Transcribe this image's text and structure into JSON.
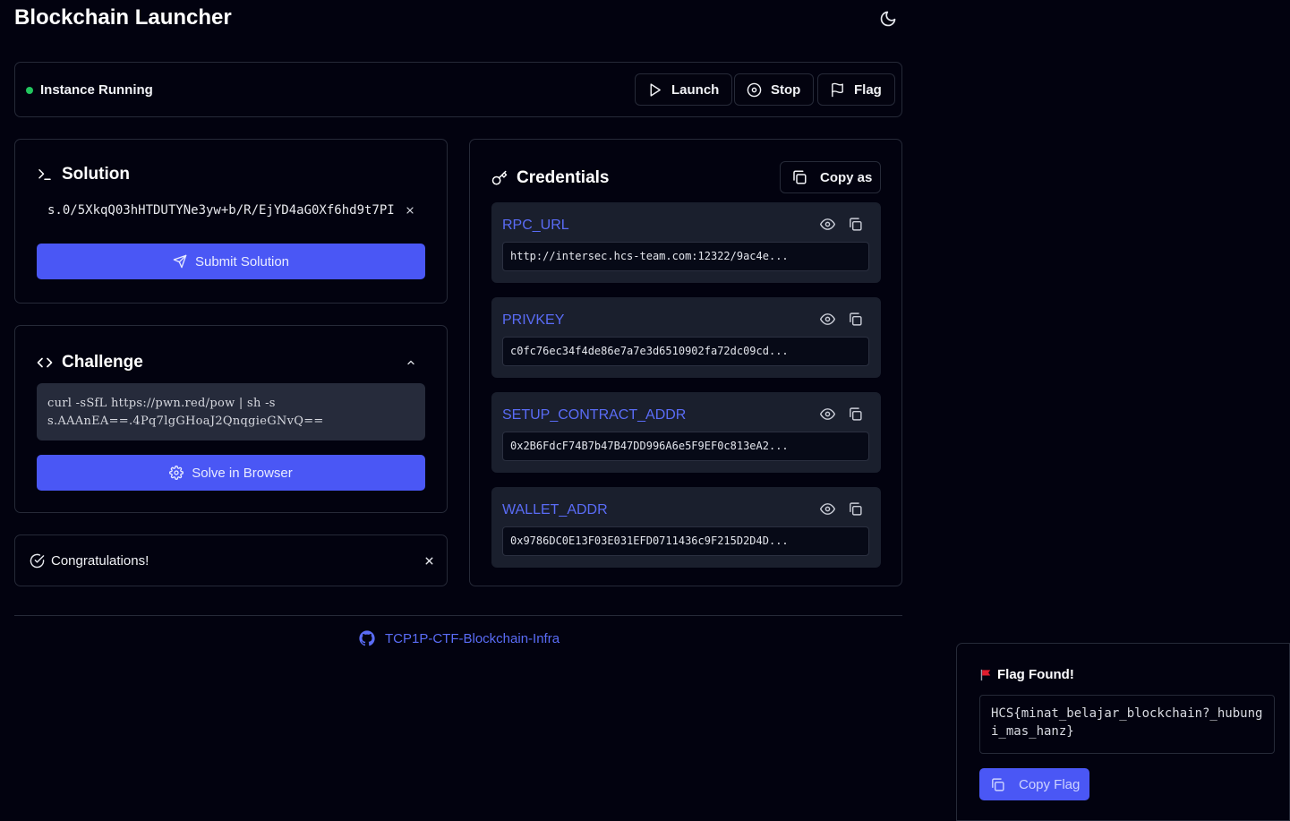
{
  "app": {
    "title": "Blockchain Launcher",
    "theme_icon": "moon-icon"
  },
  "status": {
    "text": "Instance Running",
    "dot_color": "#22c55e",
    "buttons": {
      "launch": "Launch",
      "stop": "Stop",
      "flag": "Flag"
    }
  },
  "solution": {
    "title": "Solution",
    "value": "s.0/5XkqQ03hHTDUTYNe3yw+b/R/EjYD4aG0Xf6hd9t7PI",
    "submit_label": "Submit Solution"
  },
  "challenge": {
    "title": "Challenge",
    "command_line1": "curl -sSfL https://pwn.red/pow | sh -s",
    "command_line2": "s.AAAnEA==.4Pq7lgGHoaJ2QnqgieGNvQ==",
    "solve_label": "Solve in Browser"
  },
  "alert": {
    "text": "Congratulations!"
  },
  "credentials": {
    "title": "Credentials",
    "copy_as_label": "Copy as",
    "items": [
      {
        "label": "RPC_URL",
        "value": "http://intersec.hcs-team.com:12322/9ac4e..."
      },
      {
        "label": "PRIVKEY",
        "value": "c0fc76ec34f4de86e7a7e3d6510902fa72dc09cd..."
      },
      {
        "label": "SETUP_CONTRACT_ADDR",
        "value": "0x2B6FdcF74B7b47B47DD996A6e5F9EF0c813eA2..."
      },
      {
        "label": "WALLET_ADDR",
        "value": "0x9786DC0E13F03E031EFD0711436c9F215D2D4D..."
      }
    ]
  },
  "footer": {
    "link_text": "TCP1P-CTF-Blockchain-Infra",
    "icon": "github-icon"
  },
  "toast": {
    "title": "Flag Found!",
    "flag": "HCS{minat_belajar_blockchain?_hubungi_mas_hanz}",
    "copy_label": "Copy Flag"
  },
  "colors": {
    "accent": "#4a57f5",
    "link": "#5a6cf6",
    "background": "#02020f",
    "border": "#262a38"
  }
}
